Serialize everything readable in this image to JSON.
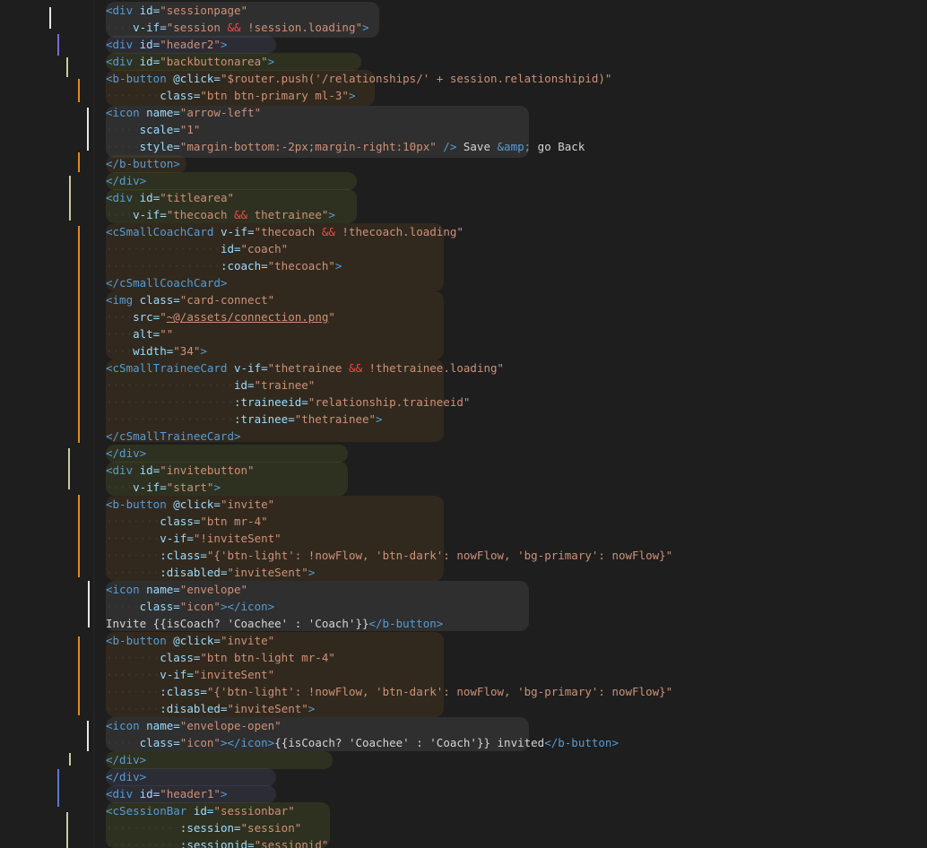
{
  "editor": {
    "language": "vue-html",
    "theme_background": "#1e1e1e",
    "colors": {
      "tag": "#569cd6",
      "attribute": "#9cdcfe",
      "string": "#ce9178",
      "operator": "#f44747",
      "text": "#d4d4d4"
    }
  },
  "lines": [
    [
      {
        "t": "tag",
        "v": "<div "
      },
      {
        "t": "attr",
        "v": "id="
      },
      {
        "t": "str",
        "v": "\"sessionpage\""
      }
    ],
    [
      {
        "t": "ind",
        "v": "····"
      },
      {
        "t": "attr",
        "v": "v-if="
      },
      {
        "t": "str",
        "v": "\"session "
      },
      {
        "t": "op",
        "v": "&&"
      },
      {
        "t": "str",
        "v": " !session.loading\""
      },
      {
        "t": "tag",
        "v": ">"
      }
    ],
    [
      {
        "t": "tag",
        "v": "<div "
      },
      {
        "t": "attr",
        "v": "id="
      },
      {
        "t": "str",
        "v": "\"header2\""
      },
      {
        "t": "tag",
        "v": ">"
      }
    ],
    [
      {
        "t": "tag",
        "v": "<div "
      },
      {
        "t": "attr",
        "v": "id="
      },
      {
        "t": "str",
        "v": "\"backbuttonarea\""
      },
      {
        "t": "tag",
        "v": ">"
      }
    ],
    [
      {
        "t": "tag",
        "v": "<b-button "
      },
      {
        "t": "attr",
        "v": "@click="
      },
      {
        "t": "str",
        "v": "\"$router.push('/relationships/' + session.relationshipid)\""
      }
    ],
    [
      {
        "t": "ind",
        "v": "········"
      },
      {
        "t": "attr",
        "v": "class="
      },
      {
        "t": "str",
        "v": "\"btn btn-primary ml-3\""
      },
      {
        "t": "tag",
        "v": ">"
      }
    ],
    [
      {
        "t": "tag",
        "v": "<icon "
      },
      {
        "t": "attr",
        "v": "name="
      },
      {
        "t": "str",
        "v": "\"arrow-left\""
      }
    ],
    [
      {
        "t": "ind",
        "v": "·····"
      },
      {
        "t": "attr",
        "v": "scale="
      },
      {
        "t": "str",
        "v": "\"1\""
      }
    ],
    [
      {
        "t": "ind",
        "v": "·····"
      },
      {
        "t": "attr",
        "v": "style="
      },
      {
        "t": "str",
        "v": "\"margin-bottom:-2px;margin-right:10px\""
      },
      {
        "t": "tag",
        "v": " />"
      },
      {
        "t": "txt",
        "v": " Save "
      },
      {
        "t": "tag",
        "v": "&amp;"
      },
      {
        "t": "txt",
        "v": " go Back"
      }
    ],
    [
      {
        "t": "tag",
        "v": "</b-button>"
      }
    ],
    [
      {
        "t": "tag",
        "v": "</div>"
      }
    ],
    [
      {
        "t": "tag",
        "v": "<div "
      },
      {
        "t": "attr",
        "v": "id="
      },
      {
        "t": "str",
        "v": "\"titlearea\""
      }
    ],
    [
      {
        "t": "ind",
        "v": "····"
      },
      {
        "t": "attr",
        "v": "v-if="
      },
      {
        "t": "str",
        "v": "\"thecoach "
      },
      {
        "t": "op",
        "v": "&&"
      },
      {
        "t": "str",
        "v": " thetrainee\""
      },
      {
        "t": "tag",
        "v": ">"
      }
    ],
    [
      {
        "t": "tag",
        "v": "<cSmallCoachCard "
      },
      {
        "t": "attr",
        "v": "v-if="
      },
      {
        "t": "str",
        "v": "\"thecoach "
      },
      {
        "t": "op",
        "v": "&&"
      },
      {
        "t": "str",
        "v": " !thecoach.loading\""
      }
    ],
    [
      {
        "t": "ind",
        "v": "·················"
      },
      {
        "t": "attr",
        "v": "id="
      },
      {
        "t": "str",
        "v": "\"coach\""
      }
    ],
    [
      {
        "t": "ind",
        "v": "·················"
      },
      {
        "t": "attr",
        "v": ":coach="
      },
      {
        "t": "str",
        "v": "\"thecoach\""
      },
      {
        "t": "tag",
        "v": ">"
      }
    ],
    [
      {
        "t": "tag",
        "v": "</cSmallCoachCard>"
      }
    ],
    [
      {
        "t": "tag",
        "v": "<img "
      },
      {
        "t": "attr",
        "v": "class="
      },
      {
        "t": "str",
        "v": "\"card-connect\""
      }
    ],
    [
      {
        "t": "ind",
        "v": "····"
      },
      {
        "t": "attr",
        "v": "src="
      },
      {
        "t": "str",
        "v": "\""
      },
      {
        "t": "lnk",
        "v": "~@/assets/connection.png"
      },
      {
        "t": "str",
        "v": "\""
      }
    ],
    [
      {
        "t": "ind",
        "v": "····"
      },
      {
        "t": "attr",
        "v": "alt="
      },
      {
        "t": "str",
        "v": "\"\""
      }
    ],
    [
      {
        "t": "ind",
        "v": "····"
      },
      {
        "t": "attr",
        "v": "width="
      },
      {
        "t": "str",
        "v": "\"34\""
      },
      {
        "t": "tag",
        "v": ">"
      }
    ],
    [
      {
        "t": "tag",
        "v": "<cSmallTraineeCard "
      },
      {
        "t": "attr",
        "v": "v-if="
      },
      {
        "t": "str",
        "v": "\"thetrainee "
      },
      {
        "t": "op",
        "v": "&&"
      },
      {
        "t": "str",
        "v": " !thetrainee.loading\""
      }
    ],
    [
      {
        "t": "ind",
        "v": "···················"
      },
      {
        "t": "attr",
        "v": "id="
      },
      {
        "t": "str",
        "v": "\"trainee\""
      }
    ],
    [
      {
        "t": "ind",
        "v": "···················"
      },
      {
        "t": "attr",
        "v": ":traineeid="
      },
      {
        "t": "str",
        "v": "\"relationship.traineeid\""
      }
    ],
    [
      {
        "t": "ind",
        "v": "···················"
      },
      {
        "t": "attr",
        "v": ":trainee="
      },
      {
        "t": "str",
        "v": "\"thetrainee\""
      },
      {
        "t": "tag",
        "v": ">"
      }
    ],
    [
      {
        "t": "tag",
        "v": "</cSmallTraineeCard>"
      }
    ],
    [
      {
        "t": "tag",
        "v": "</div>"
      }
    ],
    [
      {
        "t": "tag",
        "v": "<div "
      },
      {
        "t": "attr",
        "v": "id="
      },
      {
        "t": "str",
        "v": "\"invitebutton\""
      }
    ],
    [
      {
        "t": "ind",
        "v": "····"
      },
      {
        "t": "attr",
        "v": "v-if="
      },
      {
        "t": "str",
        "v": "\"start\""
      },
      {
        "t": "tag",
        "v": ">"
      }
    ],
    [
      {
        "t": "tag",
        "v": "<b-button "
      },
      {
        "t": "attr",
        "v": "@click="
      },
      {
        "t": "str",
        "v": "\"invite\""
      }
    ],
    [
      {
        "t": "ind",
        "v": "········"
      },
      {
        "t": "attr",
        "v": "class="
      },
      {
        "t": "str",
        "v": "\"btn mr-4\""
      }
    ],
    [
      {
        "t": "ind",
        "v": "········"
      },
      {
        "t": "attr",
        "v": "v-if="
      },
      {
        "t": "str",
        "v": "\"!inviteSent\""
      }
    ],
    [
      {
        "t": "ind",
        "v": "········"
      },
      {
        "t": "attr",
        "v": ":class="
      },
      {
        "t": "str",
        "v": "\"{'btn-light': !nowFlow, 'btn-dark': nowFlow, 'bg-primary': nowFlow}\""
      }
    ],
    [
      {
        "t": "ind",
        "v": "········"
      },
      {
        "t": "attr",
        "v": ":disabled="
      },
      {
        "t": "str",
        "v": "\"inviteSent\""
      },
      {
        "t": "tag",
        "v": ">"
      }
    ],
    [
      {
        "t": "tag",
        "v": "<icon "
      },
      {
        "t": "attr",
        "v": "name="
      },
      {
        "t": "str",
        "v": "\"envelope\""
      }
    ],
    [
      {
        "t": "ind",
        "v": "·····"
      },
      {
        "t": "attr",
        "v": "class="
      },
      {
        "t": "str",
        "v": "\"icon\""
      },
      {
        "t": "tag",
        "v": "></icon>"
      }
    ],
    [
      {
        "t": "txt",
        "v": "Invite {{isCoach? 'Coachee' : 'Coach'}}"
      },
      {
        "t": "tag",
        "v": "</b-button>"
      }
    ],
    [
      {
        "t": "tag",
        "v": "<b-button "
      },
      {
        "t": "attr",
        "v": "@click="
      },
      {
        "t": "str",
        "v": "\"invite\""
      }
    ],
    [
      {
        "t": "ind",
        "v": "········"
      },
      {
        "t": "attr",
        "v": "class="
      },
      {
        "t": "str",
        "v": "\"btn btn-light mr-4\""
      }
    ],
    [
      {
        "t": "ind",
        "v": "········"
      },
      {
        "t": "attr",
        "v": "v-if="
      },
      {
        "t": "str",
        "v": "\"inviteSent\""
      }
    ],
    [
      {
        "t": "ind",
        "v": "········"
      },
      {
        "t": "attr",
        "v": ":class="
      },
      {
        "t": "str",
        "v": "\"{'btn-light': !nowFlow, 'btn-dark': nowFlow, 'bg-primary': nowFlow}\""
      }
    ],
    [
      {
        "t": "ind",
        "v": "········"
      },
      {
        "t": "attr",
        "v": ":disabled="
      },
      {
        "t": "str",
        "v": "\"inviteSent\""
      },
      {
        "t": "tag",
        "v": ">"
      }
    ],
    [
      {
        "t": "tag",
        "v": "<icon "
      },
      {
        "t": "attr",
        "v": "name="
      },
      {
        "t": "str",
        "v": "\"envelope-open\""
      }
    ],
    [
      {
        "t": "ind",
        "v": "·····"
      },
      {
        "t": "attr",
        "v": "class="
      },
      {
        "t": "str",
        "v": "\"icon\""
      },
      {
        "t": "tag",
        "v": "></icon>"
      },
      {
        "t": "txt",
        "v": "{{isCoach? 'Coachee' : 'Coach'}} invited"
      },
      {
        "t": "tag",
        "v": "</b-button>"
      }
    ],
    [
      {
        "t": "tag",
        "v": "</div>"
      }
    ],
    [
      {
        "t": "tag",
        "v": "</div>"
      }
    ],
    [
      {
        "t": "tag",
        "v": "<div "
      },
      {
        "t": "attr",
        "v": "id="
      },
      {
        "t": "str",
        "v": "\"header1\""
      },
      {
        "t": "tag",
        "v": ">"
      }
    ],
    [
      {
        "t": "tag",
        "v": "<cSessionBar "
      },
      {
        "t": "attr",
        "v": "id="
      },
      {
        "t": "str",
        "v": "\"sessionbar\""
      }
    ],
    [
      {
        "t": "ind",
        "v": "···········"
      },
      {
        "t": "attr",
        "v": ":session="
      },
      {
        "t": "str",
        "v": "\"session\""
      }
    ],
    [
      {
        "t": "ind",
        "v": "···········"
      },
      {
        "t": "attr",
        "v": ":sessionid="
      },
      {
        "t": "str",
        "v": "\"sessionid\""
      }
    ]
  ]
}
